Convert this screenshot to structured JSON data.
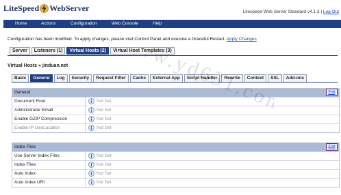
{
  "header": {
    "logo_left": "LiteSpeed",
    "logo_right": "WebServer",
    "version_text": "Litespeed Web Server Standard v4.1.3 |",
    "logout": "Log Out"
  },
  "nav": {
    "items": [
      "Home",
      "Actions",
      "Configuration",
      "Web Console",
      "Help"
    ]
  },
  "notice": {
    "text": "Configuration has been modified. To apply changes, please visit Control Panel and execute a Graceful Restart.",
    "link": "Apply Changes"
  },
  "top_tabs": [
    {
      "label": "Server"
    },
    {
      "label": "Listeners (1)"
    },
    {
      "label": "Virtual Hosts (2)",
      "active": true
    },
    {
      "label": "Virtual Host Templates (3)"
    }
  ],
  "breadcrumb": "Virtual Hosts » jinduan.net",
  "sub_tabs": [
    {
      "label": "Basic"
    },
    {
      "label": "General",
      "active": true
    },
    {
      "label": "Log"
    },
    {
      "label": "Security"
    },
    {
      "label": "Request Filter"
    },
    {
      "label": "Cache"
    },
    {
      "label": "External App"
    },
    {
      "label": "Script Handler"
    },
    {
      "label": "Rewrite"
    },
    {
      "label": "Context"
    },
    {
      "label": "SSL"
    },
    {
      "label": "Add-ons"
    }
  ],
  "sections": {
    "general": {
      "title": "General",
      "edit": "Edit",
      "rows": [
        {
          "label": "Document Root",
          "value": "Not Set"
        },
        {
          "label": "Administrator Email",
          "value": "Not Set"
        },
        {
          "label": "Enable GZIP Compression",
          "value": "Not Set"
        },
        {
          "label": "Enable IP GeoLocation",
          "value": "Not Set"
        }
      ]
    },
    "index_files": {
      "title": "Index Files",
      "edit": "Edit",
      "rows": [
        {
          "label": "Use Server Index Files",
          "value": "Not Set"
        },
        {
          "label": "Index Files",
          "value": "Not Set"
        },
        {
          "label": "Auto Index",
          "value": "Not Set"
        },
        {
          "label": "Auto Index URI",
          "value": "Not Set"
        }
      ]
    }
  },
  "watermark": "www.yd631.com",
  "colors": {
    "nav_bg": "#1e3f86",
    "section_head": "#a9bbd7",
    "link": "#1a44c8"
  }
}
